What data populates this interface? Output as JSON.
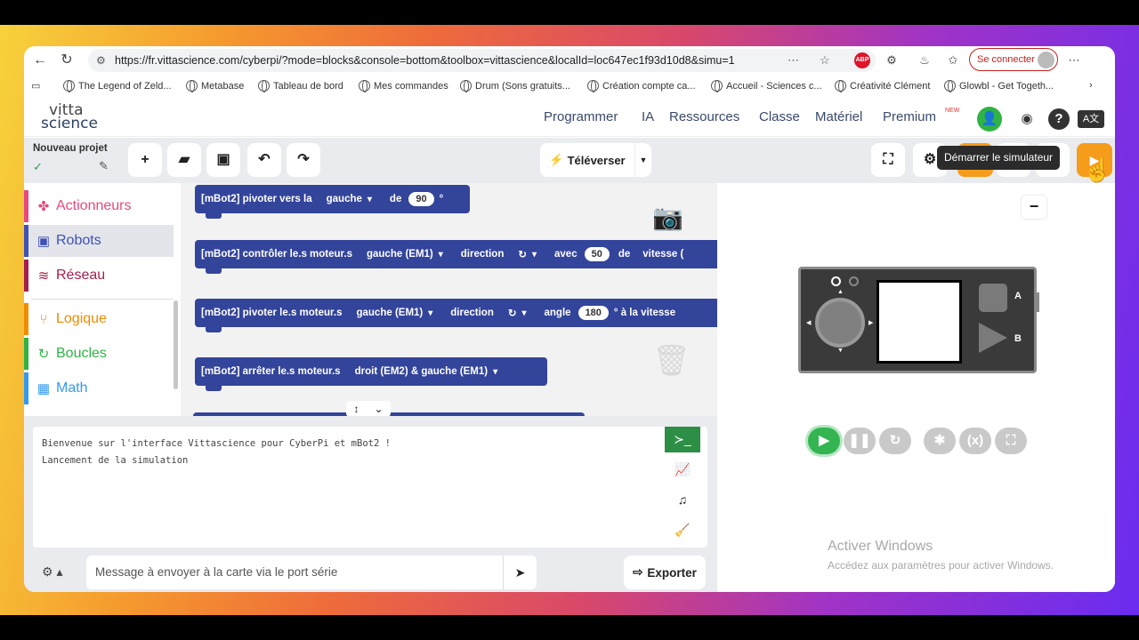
{
  "browser": {
    "url": "https://fr.vittascience.com/cyberpi/?mode=blocks&console=bottom&toolbox=vittascience&localId=loc647ec1f93d10d8&simu=1",
    "signin_label": "Se connecter",
    "bookmarks": [
      "The Legend of Zeld...",
      "Metabase",
      "Tableau de bord",
      "Mes commandes",
      "Drum (Sons gratuits...",
      "Création compte ca...",
      "Accueil - Sciences c...",
      "Créativité Clément",
      "Glowbl - Get Togeth..."
    ]
  },
  "site": {
    "logo_line1": "vitta",
    "logo_line2": "science",
    "menu": [
      "Programmer",
      "IA",
      "Ressources",
      "Classe",
      "Matériel",
      "Premium"
    ],
    "premium_badge": "NEW"
  },
  "toolbar": {
    "project_name": "Nouveau projet",
    "upload_label": "Téléverser",
    "tooltip": "Démarrer le simulateur"
  },
  "categories": [
    {
      "label": "Actionneurs",
      "color": "#e64980",
      "icon": "✤"
    },
    {
      "label": "Robots",
      "color": "#3f51b5",
      "icon": "🤖"
    },
    {
      "label": "Réseau",
      "color": "#a51d4a",
      "icon": "≋"
    },
    {
      "label": "Logique",
      "color": "#f08c00",
      "icon": "⑂"
    },
    {
      "label": "Boucles",
      "color": "#2fb344",
      "icon": "↻"
    },
    {
      "label": "Math",
      "color": "#339af0",
      "icon": "▦"
    }
  ],
  "blocks": {
    "b1": {
      "prefix": "[mBot2] pivoter vers la",
      "dir": "gauche",
      "kw": "de",
      "val": "90",
      "unit": "°"
    },
    "b2": {
      "prefix": "[mBot2] contrôler le.s moteur.s",
      "motor": "gauche (EM1)",
      "kw1": "direction",
      "rot": "↻",
      "kw2": "avec",
      "val": "50",
      "kw3": "de",
      "kw4": "vitesse ("
    },
    "b3": {
      "prefix": "[mBot2] pivoter le.s moteur.s",
      "motor": "gauche (EM1)",
      "kw1": "direction",
      "rot": "↻",
      "kw2": "angle",
      "val": "180",
      "kw3": "° à la vitesse"
    },
    "b4": {
      "prefix": "[mBot2] arrêter le.s moteur.s",
      "motor": "droit (EM2) & gauche (EM1)"
    }
  },
  "console": {
    "line1": "Bienvenue sur l'interface Vittascience pour CyberPi et mBot2 !",
    "line2": "Lancement de la simulation",
    "serial_placeholder": "Message à envoyer à la carte via le port série",
    "export_label": "Exporter"
  },
  "simulator": {
    "label_a": "A",
    "label_b": "B",
    "activate_title": "Activer Windows",
    "activate_sub": "Accédez aux paramètres pour activer Windows."
  }
}
